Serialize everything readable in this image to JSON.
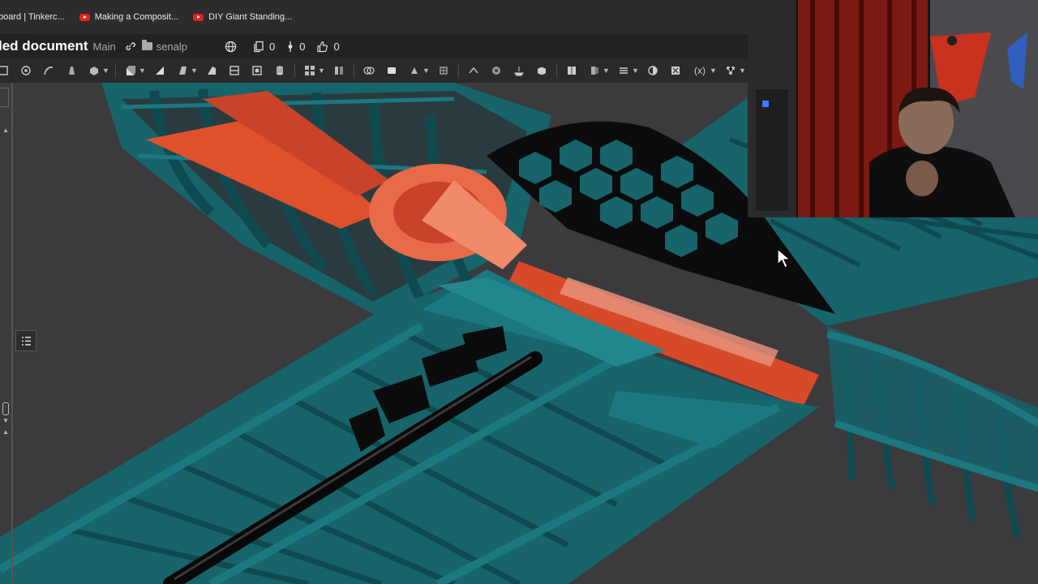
{
  "bookmarks": [
    {
      "label": "board | Tinkerc...",
      "icon": "none"
    },
    {
      "label": "Making a Composit...",
      "icon": "youtube-icon"
    },
    {
      "label": "DIY Giant Standing...",
      "icon": "youtube-icon"
    }
  ],
  "document": {
    "title": "led document",
    "branch": "Main",
    "workspace": "senalp",
    "stats": {
      "versions": "0",
      "branches": "0",
      "likes": "0"
    }
  },
  "toolbar": {
    "icons": [
      "sketch-icon",
      "fillet-icon",
      "sweep-icon",
      "loft-icon",
      "thicken-icon",
      "extrude-icon",
      "revolve-icon",
      "draft-icon",
      "shell-icon",
      "rib-icon",
      "hole-icon",
      "pattern-icon",
      "mirror-icon",
      "boolean-icon",
      "split-icon",
      "transform-icon",
      "delete-icon",
      "plane-icon",
      "helix-icon",
      "curve-icon",
      "surface-icon",
      "section-icon",
      "variable-icon",
      "mate-icon"
    ]
  },
  "viewport": {
    "model": "aircraft-fuselage-wing-assembly",
    "colors": {
      "frame": "#17646b",
      "frame_dark": "#0f4a50",
      "highlight": "#e0512b",
      "background": "#3b3b3d"
    }
  },
  "webcam": {
    "visible": true
  }
}
